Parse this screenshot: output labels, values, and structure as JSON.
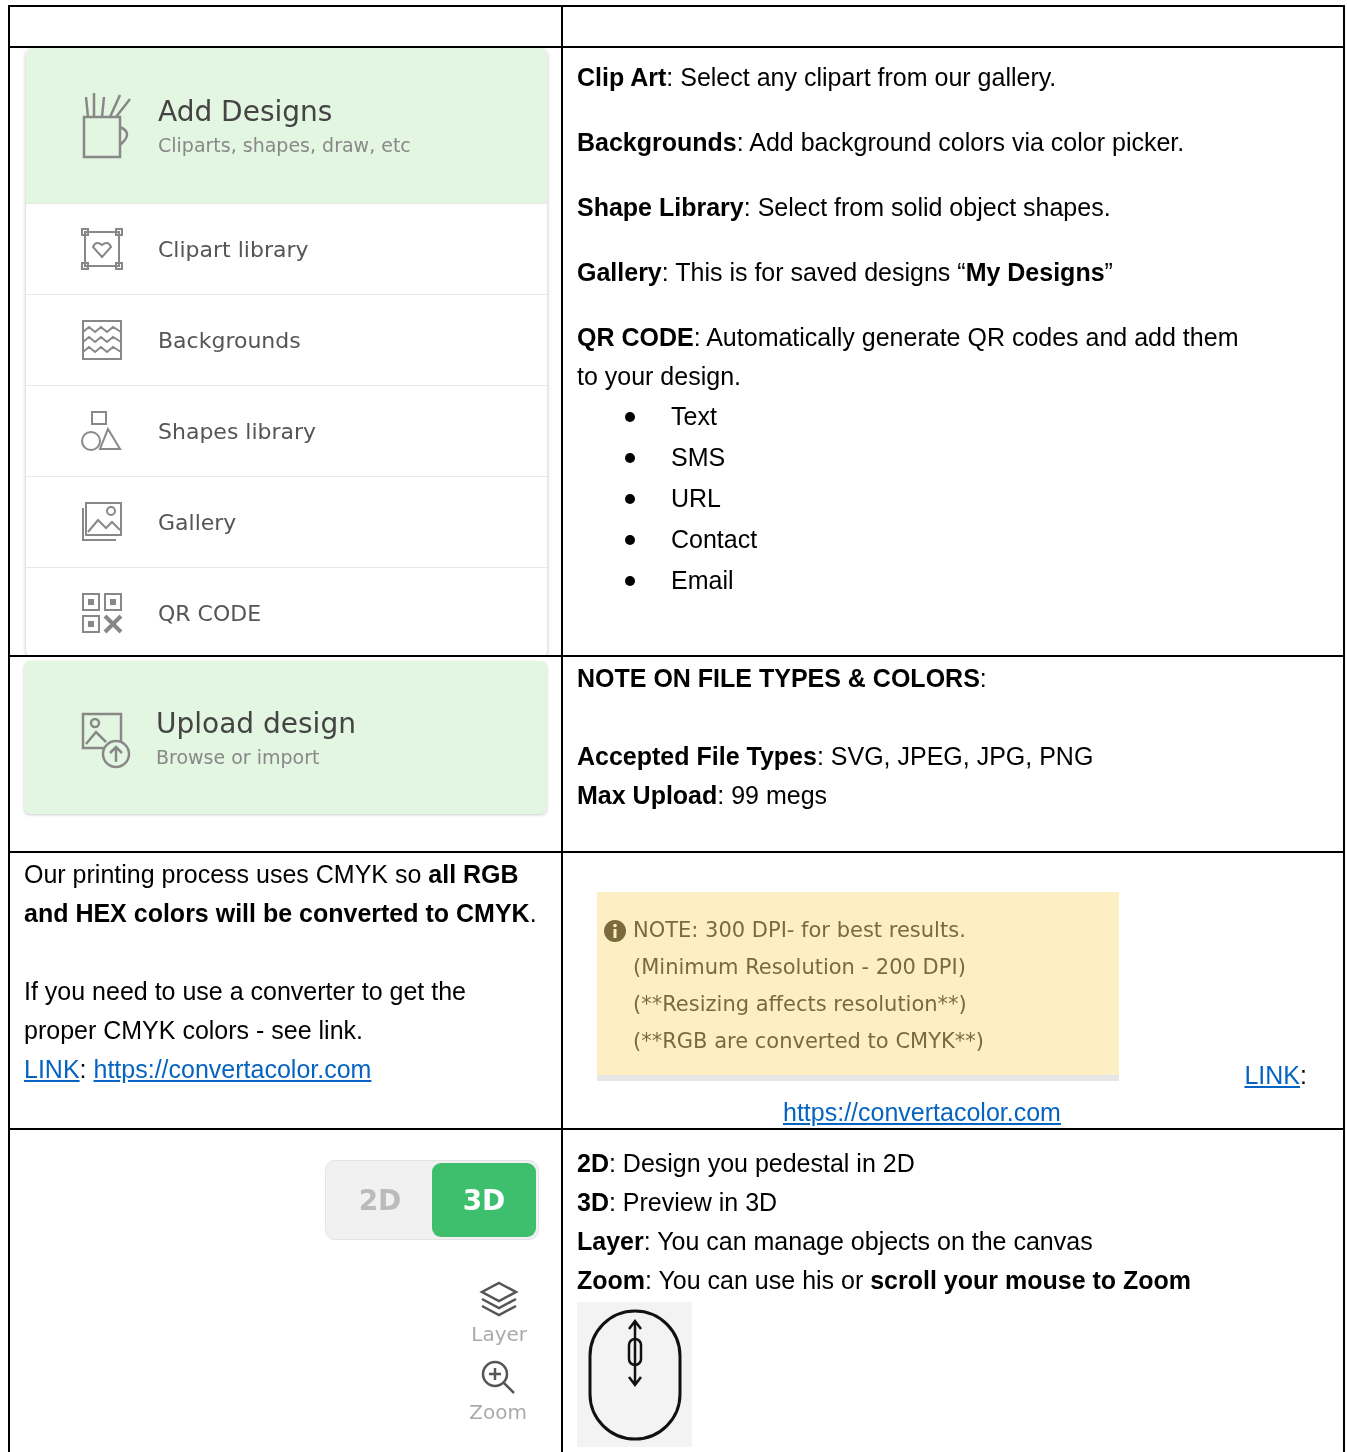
{
  "design_panel": {
    "title": "Add Designs",
    "subtitle": "Cliparts, shapes, draw, etc",
    "items": [
      {
        "kind": "clipart",
        "label": "Clipart library"
      },
      {
        "kind": "backgrounds",
        "label": "Backgrounds"
      },
      {
        "kind": "shapes",
        "label": "Shapes library"
      },
      {
        "kind": "gallery",
        "label": "Gallery"
      },
      {
        "kind": "qr",
        "label": "QR CODE"
      }
    ]
  },
  "design_notes": {
    "paragraphs": [
      "**Clip Art**: Select any clipart from our gallery.",
      "**Backgrounds**: Add background colors via color picker.",
      "**Shape Library**: Select from solid object shapes.",
      "**Gallery**: This is for saved designs “**My Designs**”",
      "**QR CODE**: Automatically generate QR codes and add them to your design."
    ],
    "bullets": [
      "Text",
      "SMS",
      "URL",
      "Contact",
      "Email"
    ]
  },
  "upload_panel": {
    "title": "Upload design",
    "subtitle": "Browse or import"
  },
  "file_notes": {
    "heading": "**NOTE ON FILE TYPES & COLORS**:",
    "lines": [
      "**Accepted File Types**: SVG, JPEG, JPG, PNG",
      "**Max Upload**: 99 megs"
    ]
  },
  "cmyk_notes": {
    "paragraphs": [
      "Our printing process uses CMYK so **all RGB and HEX colors will be converted to CMYK**.",
      "If you need to use a converter to get the proper CMYK colors -  see link."
    ],
    "link_label": "LINK",
    "link_separator": ":",
    "link_url": "https://convertacolor.com"
  },
  "dpi_notice": {
    "lines": [
      "NOTE: 300 DPI- for best results.",
      "(Minimum Resolution - 200 DPI)",
      "(**Resizing affects resolution**)",
      "(**RGB are converted to CMYK**)"
    ],
    "link_label": "LINK",
    "link_separator": ":",
    "link_url": "https://convertacolor.com"
  },
  "view_toggle": [
    {
      "label": "2D",
      "selected": false
    },
    {
      "label": "3D",
      "selected": true
    }
  ],
  "tools": [
    {
      "kind": "layer",
      "label": "Layer"
    },
    {
      "kind": "zoom",
      "label": "Zoom"
    }
  ],
  "view_notes": [
    "**2D**: Design you pedestal in 2D",
    "**3D**: Preview in 3D",
    "**Layer**: You can manage objects on the canvas",
    "**Zoom**:  You can use his or **scroll your mouse to Zoom**"
  ]
}
